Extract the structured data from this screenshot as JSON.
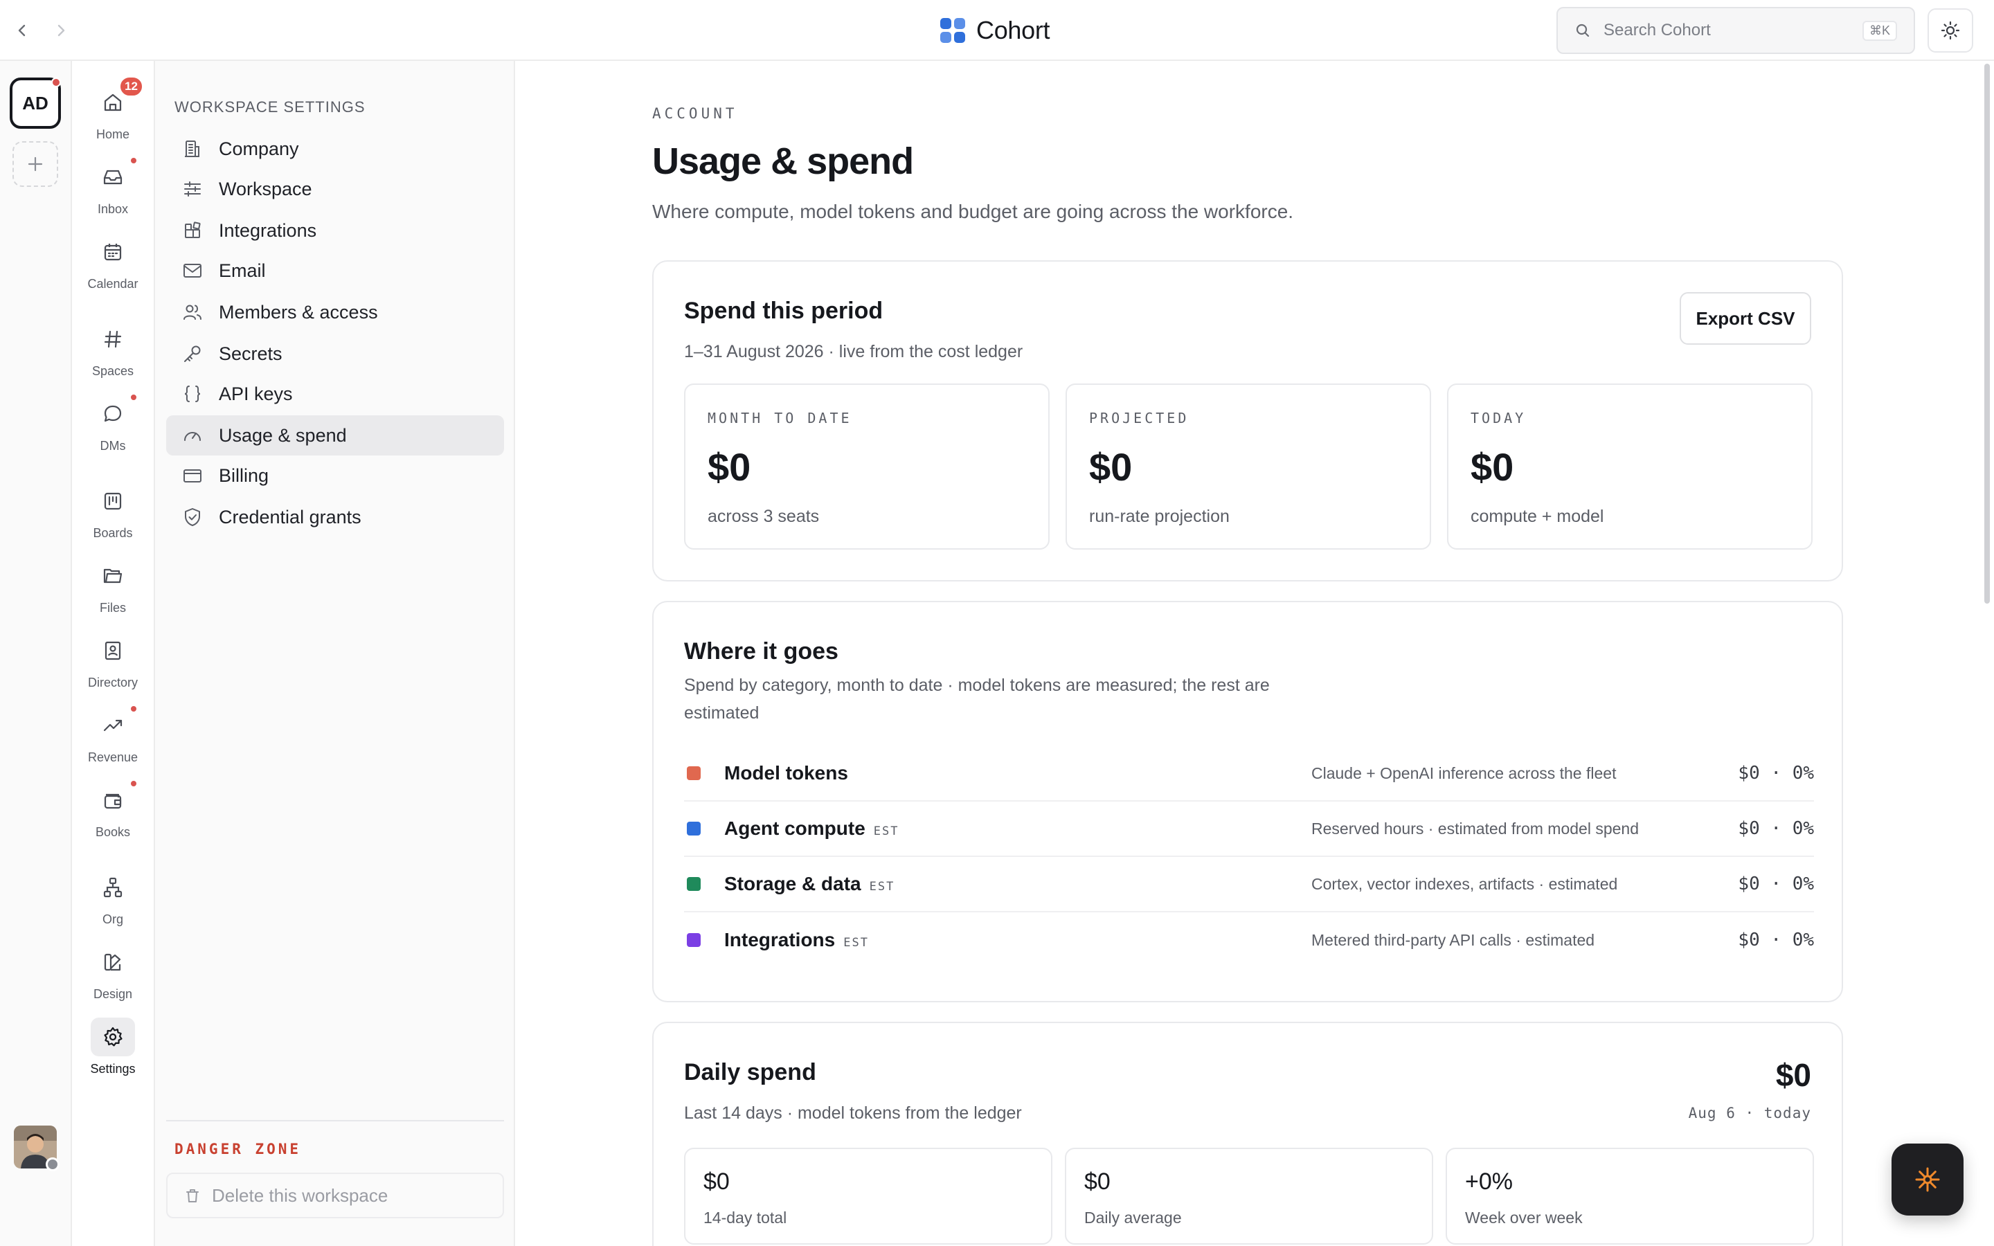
{
  "topbar": {
    "brand_name": "Cohort",
    "search_placeholder": "Search Cohort",
    "search_shortcut": "⌘K"
  },
  "workspace": {
    "initials": "AD"
  },
  "nav": {
    "items": [
      {
        "label": "Home",
        "icon": "home-icon",
        "badge": "12"
      },
      {
        "label": "Inbox",
        "icon": "inbox-icon"
      },
      {
        "label": "Calendar",
        "icon": "calendar-icon"
      },
      {
        "label": "Spaces",
        "icon": "hash-icon"
      },
      {
        "label": "DMs",
        "icon": "chat-bubble-icon"
      },
      {
        "label": "Boards",
        "icon": "kanban-icon"
      },
      {
        "label": "Files",
        "icon": "folder-icon"
      },
      {
        "label": "Directory",
        "icon": "contact-card-icon"
      },
      {
        "label": "Revenue",
        "icon": "trend-up-icon"
      },
      {
        "label": "Books",
        "icon": "wallet-icon"
      },
      {
        "label": "Org",
        "icon": "org-chart-icon"
      },
      {
        "label": "Design",
        "icon": "palette-icon"
      },
      {
        "label": "Settings",
        "icon": "gear-icon"
      }
    ]
  },
  "settings": {
    "heading": "WORKSPACE SETTINGS",
    "items": [
      {
        "label": "Company",
        "icon": "building-icon"
      },
      {
        "label": "Workspace",
        "icon": "sliders-icon"
      },
      {
        "label": "Integrations",
        "icon": "blocks-icon"
      },
      {
        "label": "Email",
        "icon": "mail-icon"
      },
      {
        "label": "Members & access",
        "icon": "users-icon"
      },
      {
        "label": "Secrets",
        "icon": "key-icon"
      },
      {
        "label": "API keys",
        "icon": "braces-icon"
      },
      {
        "label": "Usage & spend",
        "icon": "gauge-icon"
      },
      {
        "label": "Billing",
        "icon": "credit-card-icon"
      },
      {
        "label": "Credential grants",
        "icon": "shield-check-icon"
      }
    ],
    "danger_title": "DANGER ZONE",
    "delete_label": "Delete this workspace"
  },
  "page": {
    "eyebrow": "ACCOUNT",
    "title": "Usage & spend",
    "subtitle": "Where compute, model tokens and budget are going across the workforce."
  },
  "spend": {
    "title": "Spend this period",
    "subtitle": "1–31 August 2026 · live from the cost ledger",
    "export_label": "Export CSV",
    "stats": [
      {
        "label": "MONTH TO DATE",
        "value": "$0",
        "note": "across 3 seats"
      },
      {
        "label": "PROJECTED",
        "value": "$0",
        "note": "run-rate projection"
      },
      {
        "label": "TODAY",
        "value": "$0",
        "note": "compute + model"
      }
    ]
  },
  "breakdown": {
    "title": "Where it goes",
    "subtitle_line1": "Spend by category, month to date · model tokens are measured; the rest are",
    "subtitle_line2": "estimated",
    "rows": [
      {
        "name": "Model tokens",
        "est": "",
        "desc": "Claude + OpenAI inference across the fleet",
        "value": "$0 · 0%",
        "color": "#e0684f"
      },
      {
        "name": "Agent compute",
        "est": "EST",
        "desc": "Reserved hours · estimated from model spend",
        "value": "$0 · 0%",
        "color": "#2f6fdb"
      },
      {
        "name": "Storage & data",
        "est": "EST",
        "desc": "Cortex, vector indexes, artifacts · estimated",
        "value": "$0 · 0%",
        "color": "#1f8a5b"
      },
      {
        "name": "Integrations",
        "est": "EST",
        "desc": "Metered third-party API calls · estimated",
        "value": "$0 · 0%",
        "color": "#7b3fe4"
      }
    ]
  },
  "daily": {
    "title": "Daily spend",
    "subtitle": "Last 14 days · model tokens from the ledger",
    "total": "$0",
    "range": "Aug 6 · today",
    "cards": [
      {
        "value": "$0",
        "label": "14-day total"
      },
      {
        "value": "$0",
        "label": "Daily average"
      },
      {
        "value": "+0%",
        "label": "Week over week"
      }
    ]
  },
  "colors": {
    "accent_blue": "#2f6fdb",
    "danger": "#c8402f",
    "badge": "#e2574c",
    "fab": "#1f1f22",
    "fab_spark": "#f08a2c"
  }
}
